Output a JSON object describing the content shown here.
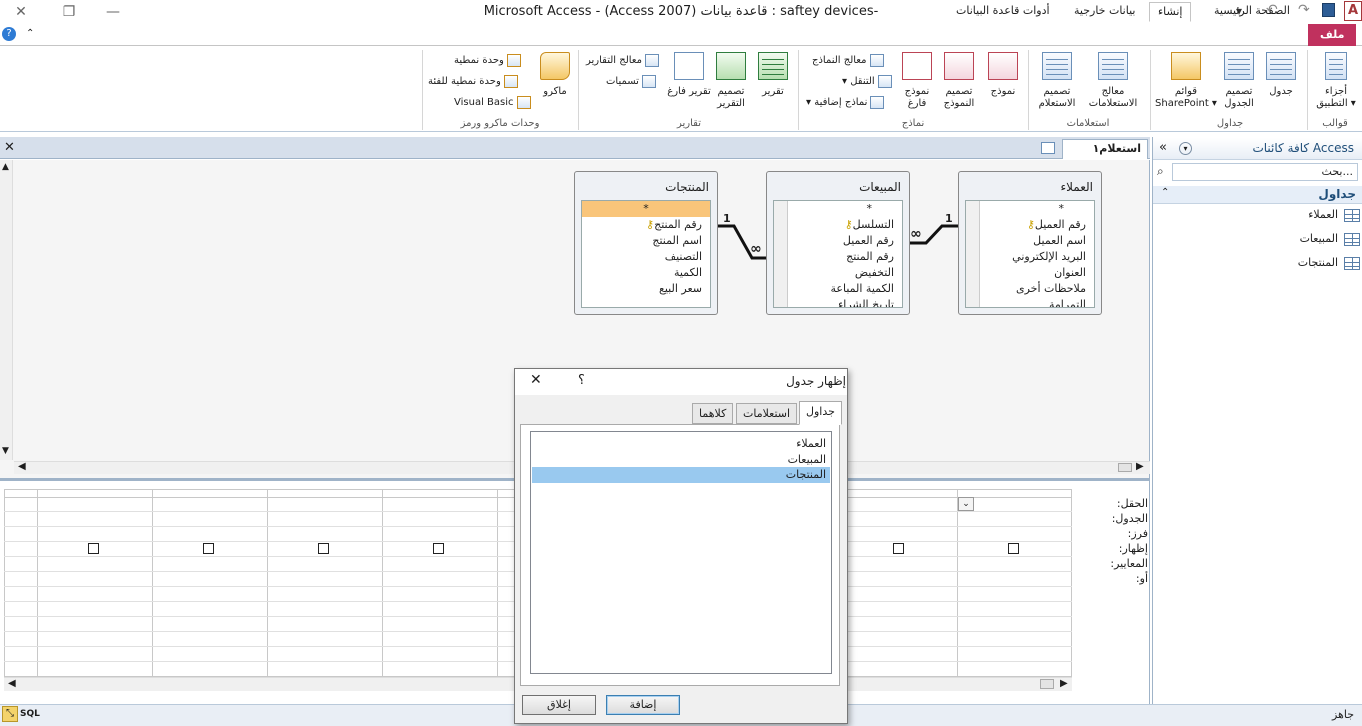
{
  "title_bar": {
    "title": "Microsoft Access  -  (Access 2007) قاعدة بيانات : saftey devices-",
    "close": "✕",
    "restore": "❐",
    "minimize": "—",
    "app_letter": "A"
  },
  "tabs": {
    "file": "ملف",
    "home": "الصفحة الرئيسية",
    "create": "إنشاء",
    "external": "بيانات خارجية",
    "dbtools": "أدوات قاعدة البيانات"
  },
  "ribbon": {
    "templates": {
      "app_parts": "أجزاء التطبيق",
      "label": "قوالب"
    },
    "tables": {
      "table": "جدول",
      "table_design": "تصميم الجدول",
      "sharepoint": "قوائم SharePoint",
      "label": "جداول"
    },
    "queries": {
      "wizard": "معالج الاستعلامات",
      "design": "تصميم الاستعلام",
      "label": "استعلامات"
    },
    "forms": {
      "form": "نموذج",
      "form_design": "تصميم النموذج",
      "blank_form": "نموذج فارغ",
      "form_wizard": "معالج النماذج",
      "navigation": "التنقل",
      "more_forms": "نماذج إضافية",
      "label": "نماذج"
    },
    "reports": {
      "report": "تقرير",
      "report_design": "تصميم التقرير",
      "blank_report": "تقرير فارغ",
      "report_wizard": "معالج التقارير",
      "labels": "تسميات",
      "label": "تقارير"
    },
    "macros": {
      "macro": "ماكرو",
      "module": "وحدة نمطية",
      "class_module": "وحدة نمطية للفئة",
      "vba": "Visual Basic",
      "label": "وحدات ماكرو ورمز"
    }
  },
  "nav_pane": {
    "header": "كافة كائنات Access",
    "search_placeholder": "بحث...",
    "group": "جداول",
    "items": [
      "العملاء",
      "المبيعات",
      "المنتجات"
    ]
  },
  "document": {
    "tab_label": "استعلام١"
  },
  "diagram_tables": [
    {
      "title": "العملاء",
      "fields": [
        "*",
        "رقم العميل",
        "اسم العميل",
        "البريد الإلكتروني",
        "العنوان",
        "ملاحظات أخرى",
        "التمرامة"
      ]
    },
    {
      "title": "المبيعات",
      "fields": [
        "*",
        "التسلسل",
        "رقم العميل",
        "رقم المنتج",
        "التخفيض",
        "الكمية المباعة",
        "تاريخ الشراء"
      ]
    },
    {
      "title": "المنتجات",
      "fields": [
        "*",
        "رقم المنتج",
        "اسم المنتج",
        "التصنيف",
        "الكمية",
        "سعر البيع"
      ]
    }
  ],
  "relationships": {
    "one": "1",
    "many": "∞"
  },
  "grid": {
    "row_labels": [
      "الحقل:",
      "الجدول:",
      "فرز:",
      "إظهار:",
      "المعايير:",
      "أو:"
    ]
  },
  "dialog": {
    "title": "إظهار جدول",
    "help": "؟",
    "close": "✕",
    "tabs": [
      "جداول",
      "استعلامات",
      "كلاهما"
    ],
    "list": [
      "العملاء",
      "المبيعات",
      "المنتجات"
    ],
    "selected_index": 2,
    "add": "إضافة",
    "close_button": "إغلاق"
  },
  "status": {
    "text": "جاهز",
    "sql": "SQL"
  }
}
